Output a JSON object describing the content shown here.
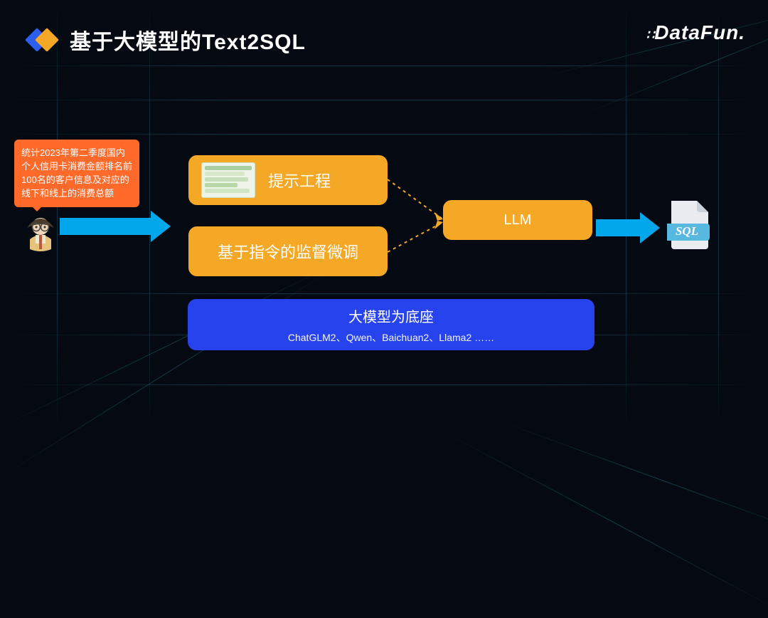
{
  "header": {
    "title": "基于大模型的Text2SQL",
    "brand": "DataFun."
  },
  "speech": {
    "text": "统计2023年第二季度国内个人信用卡消费金额排名前100名的客户信息及对应的线下和线上的消费总额"
  },
  "boxes": {
    "prompt_engineering": "提示工程",
    "supervised_finetune": "基于指令的监督微调",
    "llm": "LLM"
  },
  "output_file": {
    "label": "SQL"
  },
  "foundation": {
    "title": "大模型为底座",
    "subtitle": "ChatGLM2、Qwen、Baichuan2、Llama2 ……"
  },
  "colors": {
    "accent_orange": "#f4a825",
    "arrow_cyan": "#00a7ea",
    "speech_orange": "#ff6a2b",
    "foundation_blue": "#2643ee"
  }
}
